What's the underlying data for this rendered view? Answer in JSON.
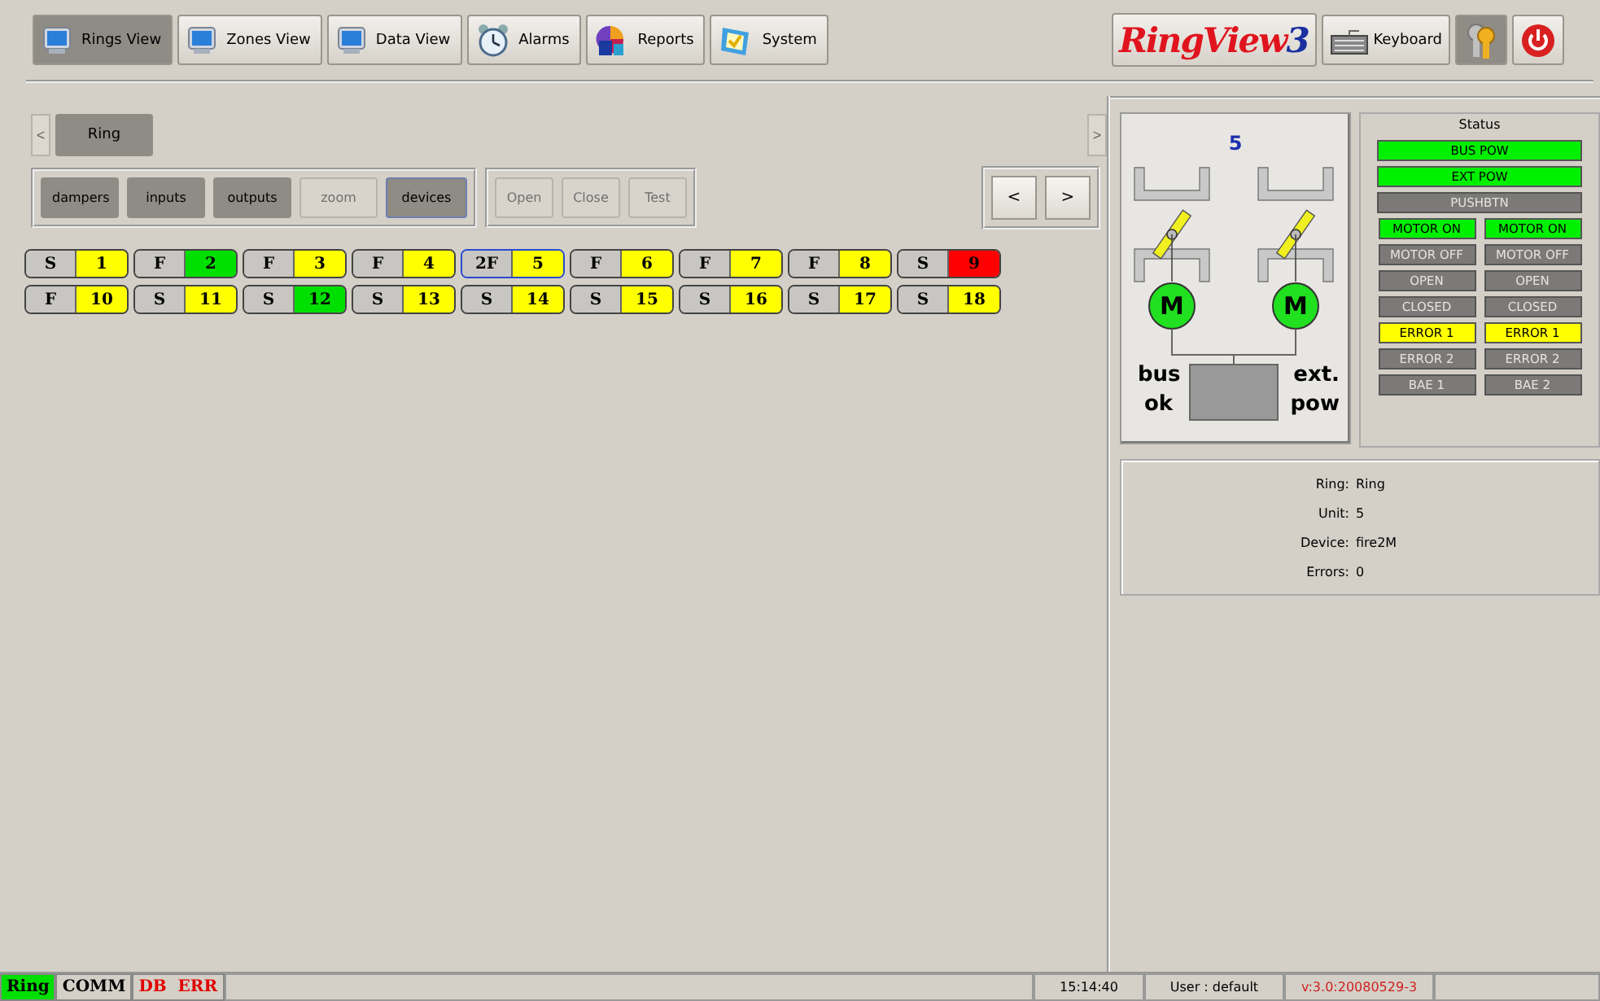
{
  "nav_tabs": [
    {
      "label": "Rings View",
      "selected": true
    },
    {
      "label": "Zones View",
      "selected": false
    },
    {
      "label": "Data View",
      "selected": false
    },
    {
      "label": "Alarms",
      "selected": false
    },
    {
      "label": "Reports",
      "selected": false
    },
    {
      "label": "System",
      "selected": false
    }
  ],
  "logo": {
    "name": "RingView",
    "version": "3"
  },
  "keyboard_button": {
    "label": "Keyboard"
  },
  "keys_button": {
    "selected": true
  },
  "ring_scroll": [
    "<",
    ">"
  ],
  "ring_tabs": [
    {
      "label": "Ring",
      "selected": true
    }
  ],
  "mode_buttons": [
    {
      "label": "dampers",
      "disabled": false,
      "selected": false
    },
    {
      "label": "inputs",
      "disabled": false,
      "selected": false
    },
    {
      "label": "outputs",
      "disabled": false,
      "selected": false
    },
    {
      "label": "zoom",
      "disabled": true,
      "selected": false
    },
    {
      "label": "devices",
      "disabled": false,
      "selected": true
    }
  ],
  "action_buttons": [
    {
      "label": "Open",
      "disabled": true
    },
    {
      "label": "Close",
      "disabled": true
    },
    {
      "label": "Test",
      "disabled": true
    }
  ],
  "page_buttons": [
    {
      "label": "<"
    },
    {
      "label": ">"
    }
  ],
  "devices": [
    {
      "type": "S",
      "number": "1",
      "color": "#ffff00",
      "selected": false
    },
    {
      "type": "F",
      "number": "2",
      "color": "#00e000",
      "selected": false
    },
    {
      "type": "F",
      "number": "3",
      "color": "#ffff00",
      "selected": false
    },
    {
      "type": "F",
      "number": "4",
      "color": "#ffff00",
      "selected": false
    },
    {
      "type": "2F",
      "number": "5",
      "color": "#ffff00",
      "selected": true
    },
    {
      "type": "F",
      "number": "6",
      "color": "#ffff00",
      "selected": false
    },
    {
      "type": "F",
      "number": "7",
      "color": "#ffff00",
      "selected": false
    },
    {
      "type": "F",
      "number": "8",
      "color": "#ffff00",
      "selected": false
    },
    {
      "type": "S",
      "number": "9",
      "color": "#ff0000",
      "selected": false
    },
    {
      "type": "F",
      "number": "10",
      "color": "#ffff00",
      "selected": false
    },
    {
      "type": "S",
      "number": "11",
      "color": "#ffff00",
      "selected": false
    },
    {
      "type": "S",
      "number": "12",
      "color": "#00e000",
      "selected": false
    },
    {
      "type": "S",
      "number": "13",
      "color": "#ffff00",
      "selected": false
    },
    {
      "type": "S",
      "number": "14",
      "color": "#ffff00",
      "selected": false
    },
    {
      "type": "S",
      "number": "15",
      "color": "#ffff00",
      "selected": false
    },
    {
      "type": "S",
      "number": "16",
      "color": "#ffff00",
      "selected": false
    },
    {
      "type": "S",
      "number": "17",
      "color": "#ffff00",
      "selected": false
    },
    {
      "type": "S",
      "number": "18",
      "color": "#ffff00",
      "selected": false
    }
  ],
  "diagram": {
    "unit": "5",
    "motors": [
      "M",
      "M"
    ],
    "left_label": "bus\nok",
    "right_label": "ext.\npow"
  },
  "status": {
    "title": "Status",
    "wide": [
      {
        "label": "BUS POW",
        "lit": true,
        "color": "#00f000"
      },
      {
        "label": "EXT POW",
        "lit": true,
        "color": "#00f000"
      },
      {
        "label": "PUSHBTN",
        "lit": false,
        "color": "#7c7a78"
      }
    ],
    "pairs": [
      [
        {
          "label": "MOTOR ON",
          "lit": true,
          "color": "#00f000"
        },
        {
          "label": "MOTOR ON",
          "lit": true,
          "color": "#00f000"
        }
      ],
      [
        {
          "label": "MOTOR OFF",
          "lit": false,
          "color": "#7c7a78"
        },
        {
          "label": "MOTOR OFF",
          "lit": false,
          "color": "#7c7a78"
        }
      ],
      [
        {
          "label": "OPEN",
          "lit": false,
          "color": "#7c7a78"
        },
        {
          "label": "OPEN",
          "lit": false,
          "color": "#7c7a78"
        }
      ],
      [
        {
          "label": "CLOSED",
          "lit": false,
          "color": "#7c7a78"
        },
        {
          "label": "CLOSED",
          "lit": false,
          "color": "#7c7a78"
        }
      ],
      [
        {
          "label": "ERROR 1",
          "lit": true,
          "color": "#ffff00"
        },
        {
          "label": "ERROR 1",
          "lit": true,
          "color": "#ffff00"
        }
      ],
      [
        {
          "label": "ERROR 2",
          "lit": false,
          "color": "#7c7a78"
        },
        {
          "label": "ERROR 2",
          "lit": false,
          "color": "#7c7a78"
        }
      ],
      [
        {
          "label": "BAE 1",
          "lit": false,
          "color": "#7c7a78"
        },
        {
          "label": "BAE 2",
          "lit": false,
          "color": "#7c7a78"
        }
      ]
    ]
  },
  "info": [
    {
      "label": "Ring:",
      "value": "Ring"
    },
    {
      "label": "Unit:",
      "value": "5"
    },
    {
      "label": "Device:",
      "value": "fire2M"
    },
    {
      "label": "Errors:",
      "value": "0"
    }
  ],
  "status_bar": {
    "left": [
      {
        "text": "Ring",
        "kind": "ok"
      },
      {
        "text": "COMM",
        "kind": "normal"
      },
      {
        "text": "DB  ERR",
        "kind": "error"
      }
    ],
    "right": [
      {
        "text": "15:14:40",
        "kind": "plain"
      },
      {
        "text": "User : default",
        "kind": "plain"
      },
      {
        "text": "v:3.0:20080529-3",
        "kind": "alert"
      }
    ]
  }
}
